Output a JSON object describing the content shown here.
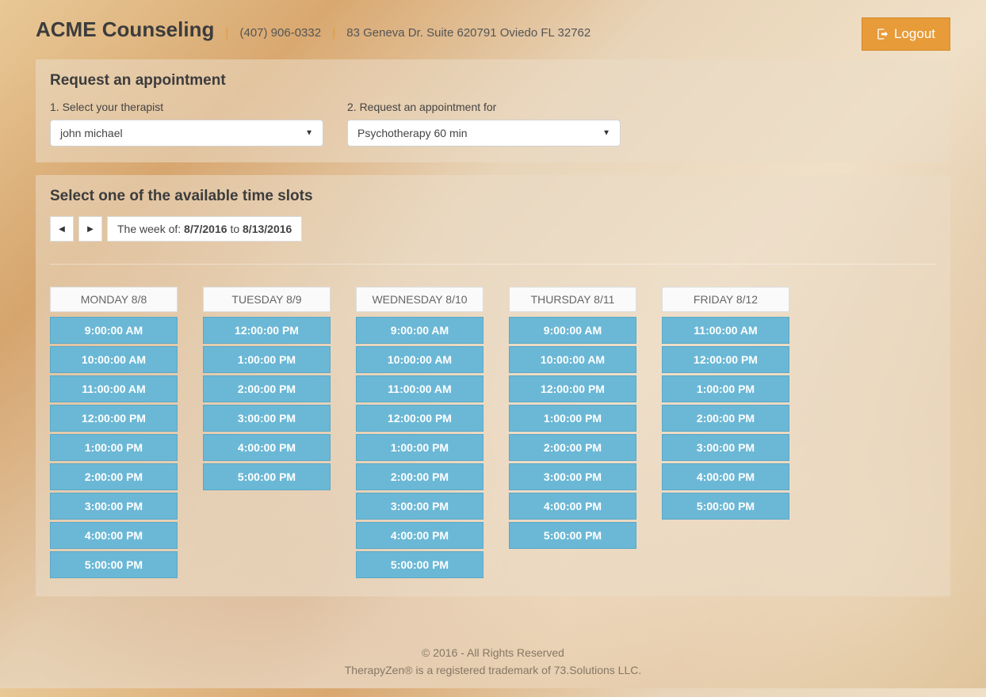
{
  "header": {
    "title": "ACME Counseling",
    "phone": "(407) 906-0332",
    "address": "83 Geneva Dr. Suite 620791 Oviedo FL 32762",
    "logout": "Logout"
  },
  "request_panel": {
    "title": "Request an appointment",
    "therapist_label": "1. Select your therapist",
    "therapist_value": "john michael",
    "service_label": "2. Request an appointment for",
    "service_value": "Psychotherapy 60 min"
  },
  "slots_panel": {
    "title": "Select one of the available time slots",
    "week_prefix": "The week of:",
    "week_start": "8/7/2016",
    "week_to": "to",
    "week_end": "8/13/2016",
    "days": [
      {
        "label": "MONDAY 8/8",
        "times": [
          "9:00:00 AM",
          "10:00:00 AM",
          "11:00:00 AM",
          "12:00:00 PM",
          "1:00:00 PM",
          "2:00:00 PM",
          "3:00:00 PM",
          "4:00:00 PM",
          "5:00:00 PM"
        ]
      },
      {
        "label": "TUESDAY 8/9",
        "times": [
          "12:00:00 PM",
          "1:00:00 PM",
          "2:00:00 PM",
          "3:00:00 PM",
          "4:00:00 PM",
          "5:00:00 PM"
        ]
      },
      {
        "label": "WEDNESDAY 8/10",
        "times": [
          "9:00:00 AM",
          "10:00:00 AM",
          "11:00:00 AM",
          "12:00:00 PM",
          "1:00:00 PM",
          "2:00:00 PM",
          "3:00:00 PM",
          "4:00:00 PM",
          "5:00:00 PM"
        ]
      },
      {
        "label": "THURSDAY 8/11",
        "times": [
          "9:00:00 AM",
          "10:00:00 AM",
          "12:00:00 PM",
          "1:00:00 PM",
          "2:00:00 PM",
          "3:00:00 PM",
          "4:00:00 PM",
          "5:00:00 PM"
        ]
      },
      {
        "label": "FRIDAY 8/12",
        "times": [
          "11:00:00 AM",
          "12:00:00 PM",
          "1:00:00 PM",
          "2:00:00 PM",
          "3:00:00 PM",
          "4:00:00 PM",
          "5:00:00 PM"
        ]
      }
    ]
  },
  "footer": {
    "line1": "© 2016 - All Rights Reserved",
    "line2": "TherapyZen® is a registered trademark of 73.Solutions LLC."
  }
}
